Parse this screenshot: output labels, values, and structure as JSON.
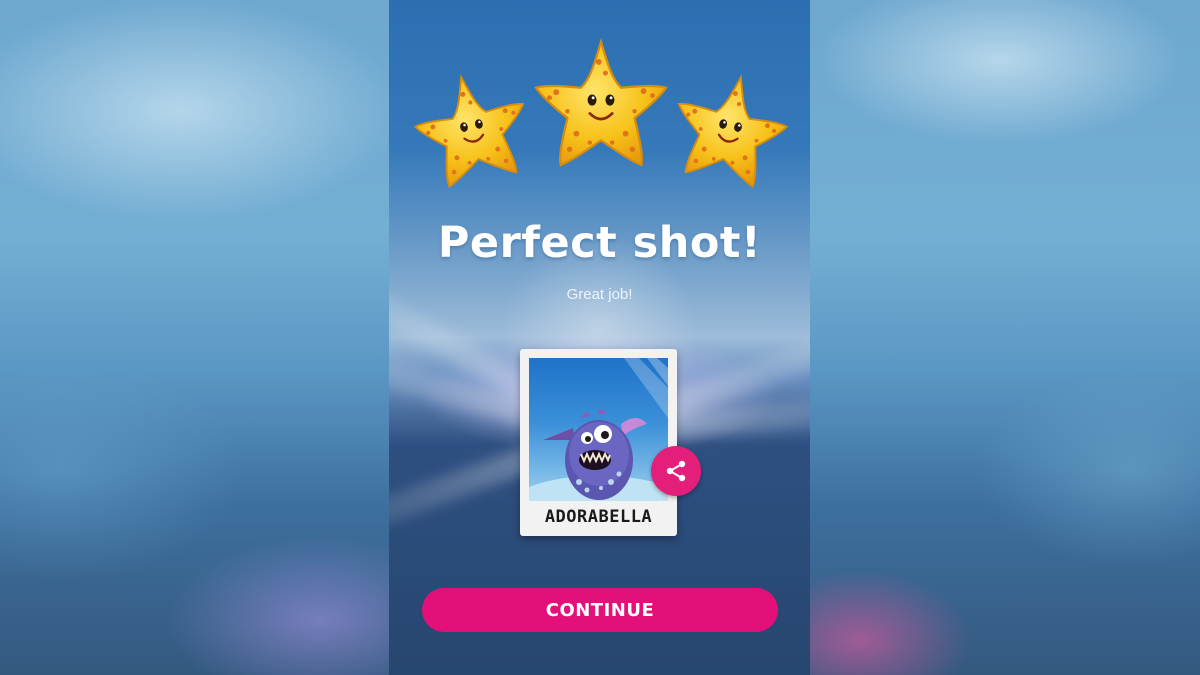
{
  "result": {
    "stars_earned": 3,
    "stars_total": 3,
    "title": "Perfect shot!",
    "subtitle": "Great job!"
  },
  "photo_card": {
    "creature_name": "ADORABELLA"
  },
  "actions": {
    "share_icon": "share-icon",
    "continue_label": "CONTINUE"
  },
  "colors": {
    "accent_pink": "#e3107a",
    "star_yellow": "#f7c21a",
    "star_spots": "#e0731c"
  }
}
